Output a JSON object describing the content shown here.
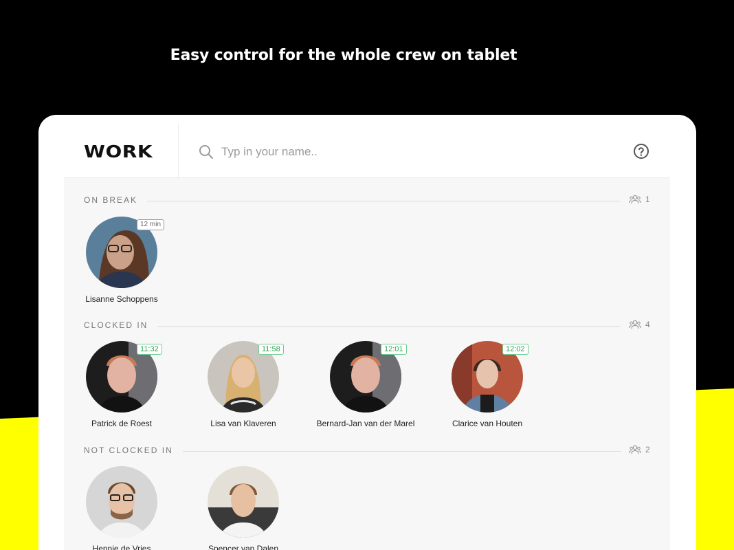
{
  "headline": "Easy control for the whole crew on tablet",
  "app": {
    "logo": "WORK",
    "search": {
      "placeholder": "Typ in your name.."
    },
    "help_icon": "help-circle-icon"
  },
  "colors": {
    "background": "#000000",
    "accent_band": "#ffff00",
    "clock_badge": "#2e9e55"
  },
  "sections": {
    "on_break": {
      "title": "ON BREAK",
      "count": "1",
      "people": [
        {
          "name": "Lisanne Schoppens",
          "badge": "12 min",
          "avatar_colors": [
            "#5a7f9a",
            "#caa189",
            "#5a3825"
          ]
        }
      ]
    },
    "clocked_in": {
      "title": "CLOCKED IN",
      "count": "4",
      "people": [
        {
          "name": "Patrick de Roest",
          "badge": "11:32",
          "avatar_colors": [
            "#1d1d1d",
            "#e2b3a2",
            "#c97a55"
          ]
        },
        {
          "name": "Lisa van Klaveren",
          "badge": "11:58",
          "avatar_colors": [
            "#c9c5be",
            "#eac6a6",
            "#d8b070"
          ]
        },
        {
          "name": "Bernard-Jan van der Marel",
          "badge": "12:01",
          "avatar_colors": [
            "#1d1d1d",
            "#e2b3a2",
            "#c97a55"
          ]
        },
        {
          "name": "Clarice van Houten",
          "badge": "12:02",
          "avatar_colors": [
            "#b8553c",
            "#e6c3ac",
            "#3a2a22"
          ]
        }
      ]
    },
    "not_clocked_in": {
      "title": "NOT CLOCKED IN",
      "count": "2",
      "people": [
        {
          "name": "Hennie de Vries",
          "avatar_colors": [
            "#d6d6d6",
            "#e8c2a6",
            "#6b4a2e"
          ]
        },
        {
          "name": "Spencer van Dalen",
          "avatar_colors": [
            "#e4e0d8",
            "#e7bfa1",
            "#7a5a3a"
          ]
        }
      ]
    }
  }
}
